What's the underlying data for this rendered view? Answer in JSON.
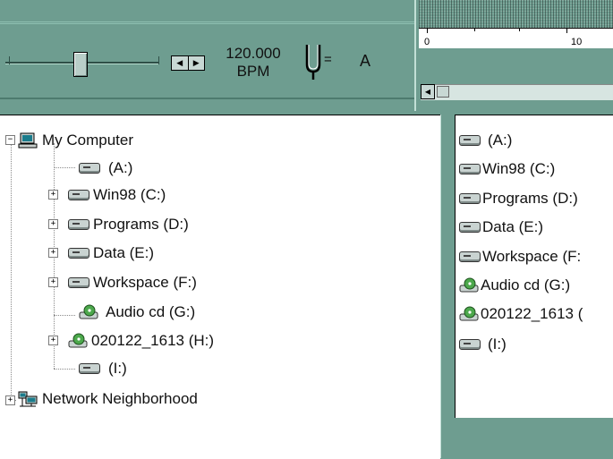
{
  "transport": {
    "tempo_value": "120.000",
    "tempo_unit": "BPM",
    "pitch_equals": "=",
    "pitch_key": "A"
  },
  "timeline": {
    "ruler_labels": [
      "0",
      "10"
    ]
  },
  "tree": {
    "root": "My Computer",
    "items": [
      {
        "label": "(A:)",
        "icon": "floppy-drive-icon",
        "expandable": false
      },
      {
        "label": "Win98 (C:)",
        "icon": "hard-drive-icon",
        "expandable": true
      },
      {
        "label": "Programs (D:)",
        "icon": "hard-drive-icon",
        "expandable": true
      },
      {
        "label": "Data (E:)",
        "icon": "hard-drive-icon",
        "expandable": true
      },
      {
        "label": "Workspace (F:)",
        "icon": "hard-drive-icon",
        "expandable": true
      },
      {
        "label": "Audio cd (G:)",
        "icon": "cd-drive-icon",
        "expandable": false
      },
      {
        "label": "020122_1613 (H:)",
        "icon": "cd-drive-icon",
        "expandable": true
      },
      {
        "label": "(I:)",
        "icon": "removable-drive-icon",
        "expandable": false
      }
    ],
    "network": "Network Neighborhood"
  },
  "list": {
    "items": [
      {
        "label": "(A:)",
        "icon": "floppy-drive-icon"
      },
      {
        "label": "Win98 (C:)",
        "icon": "hard-drive-icon"
      },
      {
        "label": "Programs (D:)",
        "icon": "hard-drive-icon"
      },
      {
        "label": "Data (E:)",
        "icon": "hard-drive-icon"
      },
      {
        "label": "Workspace (F:",
        "icon": "hard-drive-icon"
      },
      {
        "label": "Audio cd (G:)",
        "icon": "cd-drive-icon"
      },
      {
        "label": "020122_1613 (",
        "icon": "cd-drive-icon"
      },
      {
        "label": "(I:)",
        "icon": "removable-drive-icon"
      }
    ]
  },
  "colors": {
    "panel": "#6e9d90",
    "pane": "#ffffff"
  }
}
